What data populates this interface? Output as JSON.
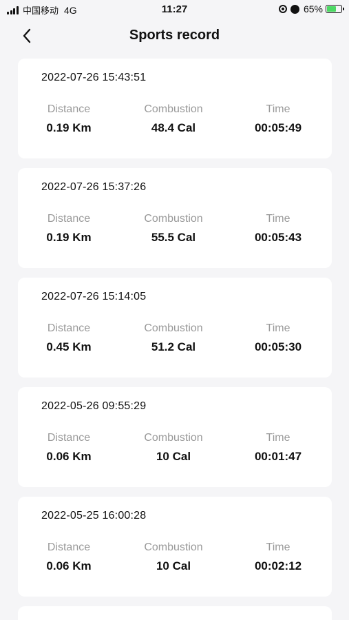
{
  "status_bar": {
    "carrier": "中国移动",
    "network": "4G",
    "time": "11:27",
    "battery_percent": "65%",
    "battery_level": 0.65,
    "battery_color": "#4cd964"
  },
  "nav": {
    "title": "Sports record",
    "back_icon": "chevron-left-icon"
  },
  "labels": {
    "distance": "Distance",
    "combustion": "Combustion",
    "time": "Time"
  },
  "records": [
    {
      "date": "2022-07-26 15:43:51",
      "distance": "0.19 Km",
      "combustion": "48.4 Cal",
      "time": "00:05:49"
    },
    {
      "date": "2022-07-26 15:37:26",
      "distance": "0.19 Km",
      "combustion": "55.5 Cal",
      "time": "00:05:43"
    },
    {
      "date": "2022-07-26 15:14:05",
      "distance": "0.45 Km",
      "combustion": "51.2 Cal",
      "time": "00:05:30"
    },
    {
      "date": "2022-05-26 09:55:29",
      "distance": "0.06 Km",
      "combustion": "10 Cal",
      "time": "00:01:47"
    },
    {
      "date": "2022-05-25 16:00:28",
      "distance": "0.06 Km",
      "combustion": "10 Cal",
      "time": "00:02:12"
    }
  ]
}
